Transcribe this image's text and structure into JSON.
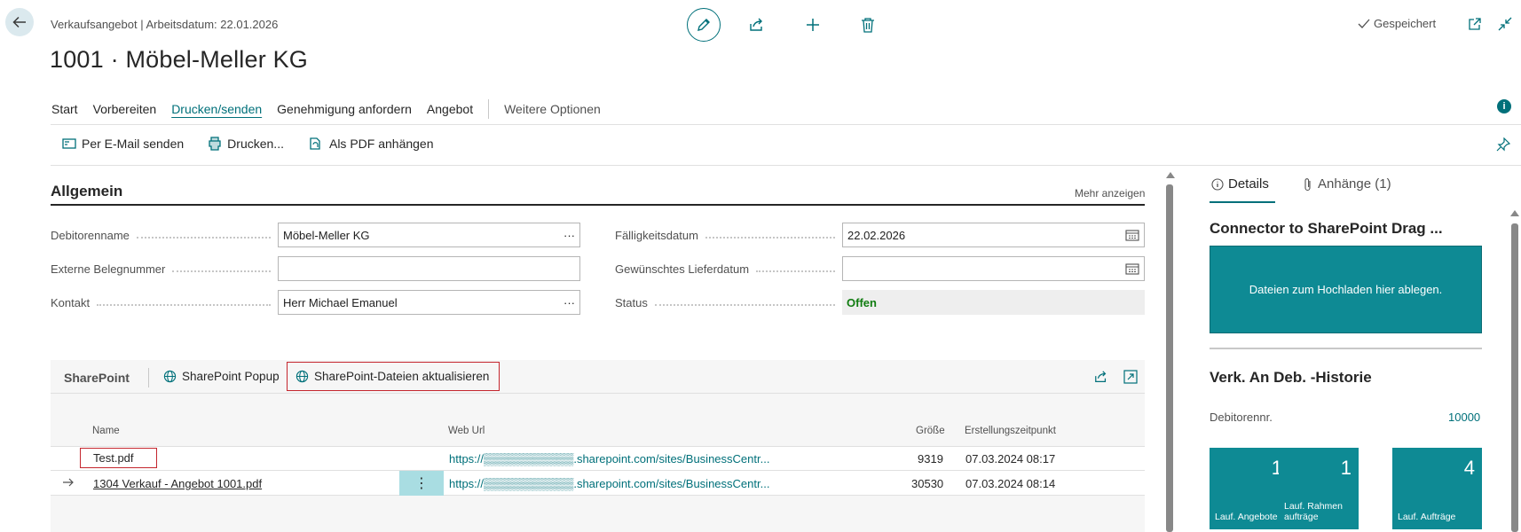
{
  "header": {
    "subtitle": "Verkaufsangebot | Arbeitsdatum: 22.01.2026",
    "title": "1001 · Möbel-Meller KG",
    "saved_label": "Gespeichert"
  },
  "tabs": [
    {
      "label": "Start"
    },
    {
      "label": "Vorbereiten"
    },
    {
      "label": "Drucken/senden"
    },
    {
      "label": "Genehmigung anfordern"
    },
    {
      "label": "Angebot"
    }
  ],
  "tabs_more": "Weitere Optionen",
  "actions": {
    "email": "Per E-Mail senden",
    "print": "Drucken...",
    "pdf": "Als PDF anhängen"
  },
  "general": {
    "title": "Allgemein",
    "show_more": "Mehr anzeigen",
    "fields": {
      "customer_name_label": "Debitorenname",
      "customer_name": "Möbel-Meller KG",
      "ext_doc_label": "Externe Belegnummer",
      "ext_doc": "",
      "contact_label": "Kontakt",
      "contact": "Herr Michael Emanuel",
      "due_date_label": "Fälligkeitsdatum",
      "due_date": "22.02.2026",
      "req_delivery_label": "Gewünschtes Lieferdatum",
      "req_delivery": "",
      "status_label": "Status",
      "status": "Offen"
    },
    "ellipsis": "···"
  },
  "sharepoint": {
    "title": "SharePoint",
    "popup_label": "SharePoint Popup",
    "refresh_label": "SharePoint-Dateien aktualisieren",
    "columns": {
      "name": "Name",
      "url": "Web Url",
      "size": "Größe",
      "created": "Erstellungszeitpunkt"
    },
    "rows": [
      {
        "name": "Test.pdf",
        "url": "https://▒▒▒▒▒▒▒▒▒▒▒.sharepoint.com/sites/BusinessCentr...",
        "size": "9319",
        "created": "07.03.2024 08:17"
      },
      {
        "name": "1304 Verkauf - Angebot 1001.pdf",
        "url": "https://▒▒▒▒▒▒▒▒▒▒▒.sharepoint.com/sites/BusinessCentr...",
        "size": "30530",
        "created": "07.03.2024 08:14"
      }
    ],
    "row_menu": "⋮"
  },
  "factbox": {
    "tab_details": "Details",
    "tab_attachments": "Anhänge (1)",
    "connector_title": "Connector to SharePoint Drag ...",
    "drop_text": "Dateien zum Hochladen hier ablegen.",
    "history_title": "Verk. An Deb. -Historie",
    "customer_no_label": "Debitorennr.",
    "customer_no": "10000",
    "cues": [
      {
        "value": "1",
        "label": "Lauf. Angebote"
      },
      {
        "value": "1",
        "label": "Lauf. Rahmenaufträge"
      },
      {
        "value": "4",
        "label": "Lauf. Aufträge"
      }
    ]
  },
  "colors": {
    "accent": "#00707a",
    "cue": "#0e8a94",
    "highlight": "#c4262e",
    "status": "#107c10"
  }
}
